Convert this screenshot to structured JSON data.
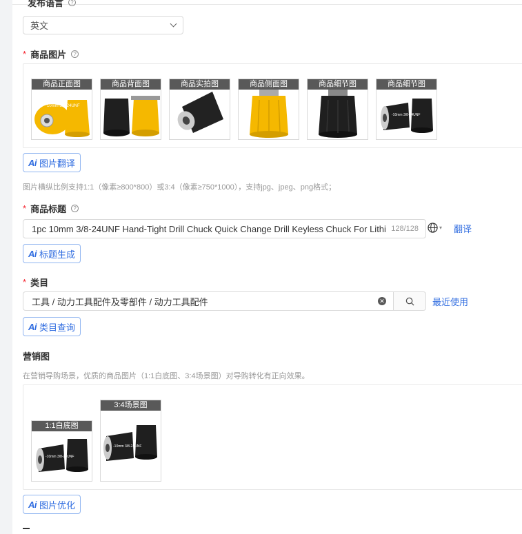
{
  "language": {
    "label": "发布语言",
    "value": "英文"
  },
  "images": {
    "label": "商品图片",
    "thumbs": [
      {
        "caption": "商品正面图",
        "overlay": "10mm 3/8-24UNF"
      },
      {
        "caption": "商品背面图",
        "overlay": ""
      },
      {
        "caption": "商品实拍图",
        "overlay": ""
      },
      {
        "caption": "商品侧面图",
        "overlay": ""
      },
      {
        "caption": "商品细节图",
        "overlay": ""
      },
      {
        "caption": "商品细节图",
        "overlay": "-10mm 3/8-24UNF"
      }
    ],
    "translate_button": "图片翻译",
    "hint": "图片横纵比例支持1:1（像素≥800*800）或3:4（像素≥750*1000），支持jpg、jpeg、png格式；"
  },
  "title": {
    "label": "商品标题",
    "value": "1pc 10mm 3/8-24UNF Hand-Tight Drill Chuck Quick Change Drill Keyless Chuck For Lithium",
    "counter": "128/128",
    "translate_link": "翻译",
    "generate_button": "标题生成"
  },
  "category": {
    "label": "类目",
    "value": "工具 / 动力工具配件及零部件 / 动力工具配件",
    "recent_link": "最近使用",
    "query_button": "类目查询"
  },
  "marketing": {
    "label": "营销图",
    "hint": "在营销导购场景，优质的商品图片（1:1白底图、3:4场景图）对导购转化有正向效果。",
    "thumbs": [
      {
        "caption": "1:1白底图",
        "overlay": "-10mm 3/8-24UNF"
      },
      {
        "caption": "3:4场景图",
        "overlay": "-10mm 3/8-24UNF"
      }
    ],
    "optimize_button": "图片优化"
  },
  "colors": {
    "accent": "#2f6ce0",
    "required": "#f5222d",
    "chuck_yellow": "#f5b800",
    "chuck_black": "#1f1f1f"
  }
}
